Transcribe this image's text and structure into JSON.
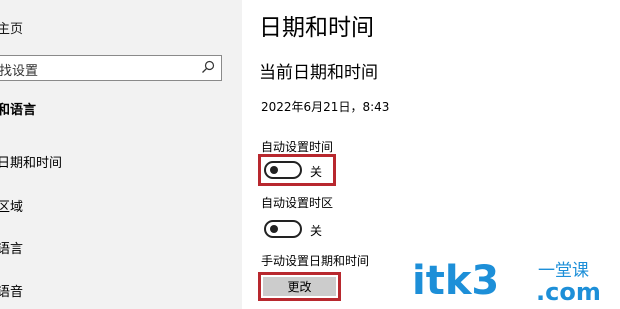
{
  "sidebar": {
    "home": "主页",
    "search_placeholder": "找设置",
    "section": "和语言",
    "items": [
      {
        "label": "日期和时间"
      },
      {
        "label": "区域"
      },
      {
        "label": "语言"
      },
      {
        "label": "语音"
      }
    ]
  },
  "main": {
    "title": "日期和时间",
    "subtitle": "当前日期和时间",
    "current_datetime": "2022年6月21日，8:43",
    "auto_time": {
      "label": "自动设置时间",
      "state": "关"
    },
    "auto_timezone": {
      "label": "自动设置时区",
      "state": "关"
    },
    "manual": {
      "label": "手动设置日期和时间",
      "button": "更改"
    }
  },
  "watermark": {
    "domain": "itk3",
    "suffix": ".com",
    "tagline": "一堂课"
  },
  "colors": {
    "highlight": "#b8282e",
    "watermark": "#1d8fd8",
    "sidebar_bg": "#f2f2f2"
  }
}
